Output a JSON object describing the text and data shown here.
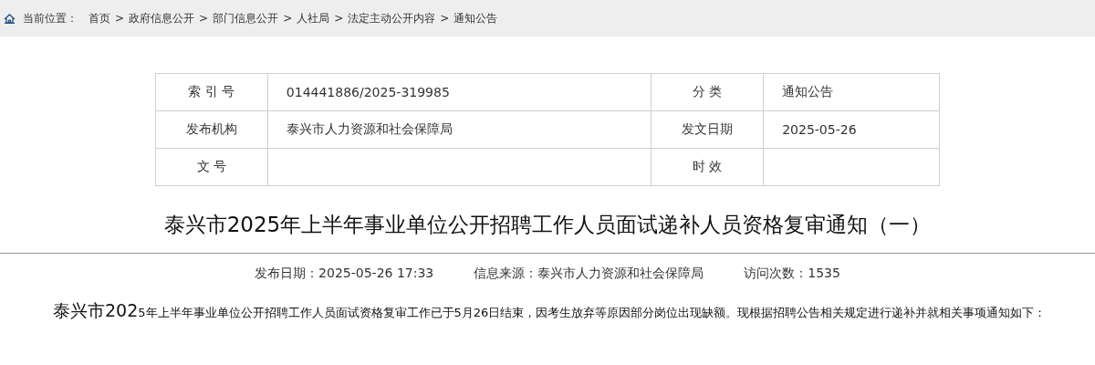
{
  "breadcrumb": {
    "label": "当前位置：",
    "separator": ">",
    "items": [
      "首页",
      "政府信息公开",
      "部门信息公开",
      "人社局",
      "法定主动公开内容",
      "通知公告"
    ]
  },
  "info_table": {
    "rows": [
      {
        "cells": [
          {
            "label": "索 引 号",
            "value": "014441886/2025-319985"
          },
          {
            "label": "分 类",
            "value": "通知公告"
          }
        ]
      },
      {
        "cells": [
          {
            "label": "发布机构",
            "value": "泰兴市人力资源和社会保障局"
          },
          {
            "label": "发文日期",
            "value": "2025-05-26"
          }
        ]
      },
      {
        "cells": [
          {
            "label": "文 号"
          },
          {
            "label": "时 效"
          }
        ]
      }
    ]
  },
  "article": {
    "title": "泰兴市2025年上半年事业单位公开招聘工作人员面试递补人员资格复审通知（一）",
    "meta": [
      "发布日期：2025-05-26 17:33",
      "信息来源：泰兴市人力资源和社会保障局",
      "访问次数：1535"
    ],
    "paragraph": {
      "lead": "泰兴市202",
      "text": "5年上半年事业单位公开招聘工作人员面试资格复审工作已于5月26日结束，因考生放弃等原因部分岗位出现缺额。现根据招聘公告相关规定进行递补并就相关事项通知如下："
    }
  }
}
